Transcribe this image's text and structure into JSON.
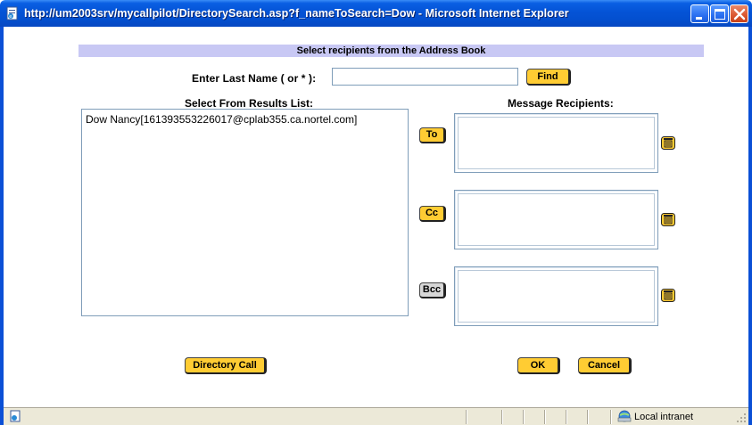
{
  "window": {
    "title": "http://um2003srv/mycallpilot/DirectorySearch.asp?f_nameToSearch=Dow - Microsoft Internet Explorer",
    "icon": "ie-page-icon",
    "controls": [
      "minimize-icon",
      "maximize-icon",
      "close-icon"
    ]
  },
  "banner": {
    "text": "Select recipients from the Address Book"
  },
  "search": {
    "label": "Enter Last Name ( or * ):",
    "value": "",
    "find_label": "Find"
  },
  "results": {
    "label": "Select From Results List:",
    "items": [
      "Dow Nancy[161393553226017@cplab355.ca.nortel.com]"
    ]
  },
  "recipients": {
    "label": "Message Recipients:",
    "to_label": "To",
    "cc_label": "Cc",
    "bcc_label": "Bcc",
    "to_value": "",
    "cc_value": "",
    "bcc_value": ""
  },
  "footer": {
    "directory_call_label": "Directory Call",
    "ok_label": "OK",
    "cancel_label": "Cancel"
  },
  "statusbar": {
    "zone_text": "Local intranet",
    "zone_icon": "local-intranet-icon"
  },
  "colors": {
    "button_accent": "#ffcc33",
    "banner_bg": "#c8c8f4",
    "titlebar": "#0453d6"
  }
}
